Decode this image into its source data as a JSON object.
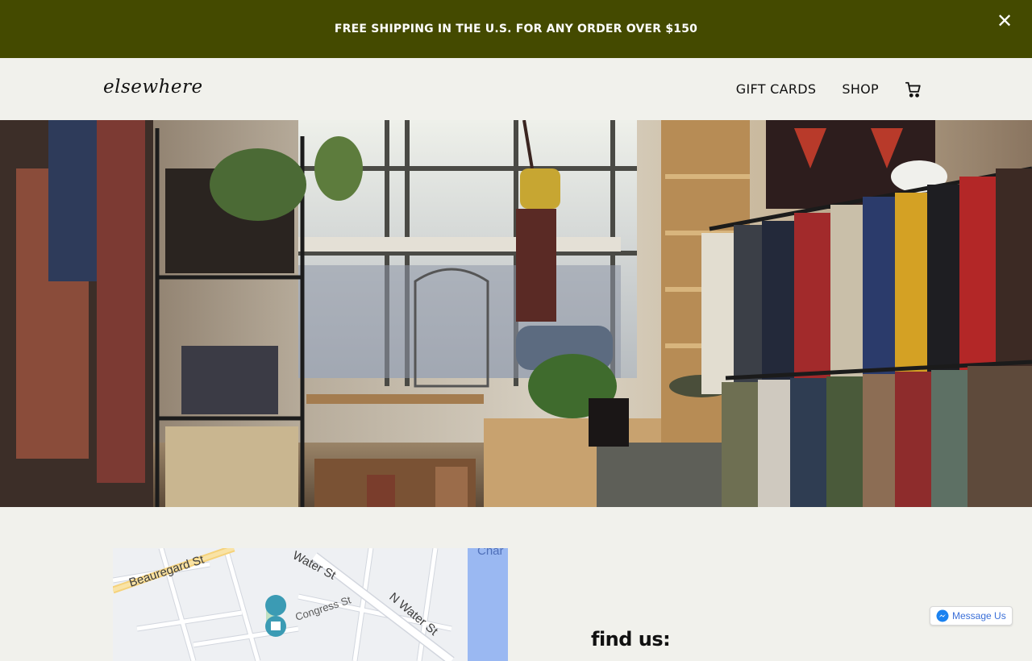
{
  "announcement": {
    "text": "FREE SHIPPING IN THE U.S. FOR ANY ORDER OVER $150",
    "close_glyph": "✕",
    "bg_color": "#444a00"
  },
  "header": {
    "logo": "elsewhere",
    "nav": [
      {
        "label": "GIFT CARDS"
      },
      {
        "label": "SHOP"
      }
    ],
    "cart_icon": "cart-icon"
  },
  "map": {
    "streets": [
      {
        "label": "Beauregard St"
      },
      {
        "label": "Water St"
      },
      {
        "label": "N Water St"
      },
      {
        "label": "Congress St"
      },
      {
        "label": "Char"
      }
    ]
  },
  "find_us": {
    "title": "find us:"
  },
  "messenger": {
    "label": "Message Us",
    "icon": "messenger-icon"
  }
}
